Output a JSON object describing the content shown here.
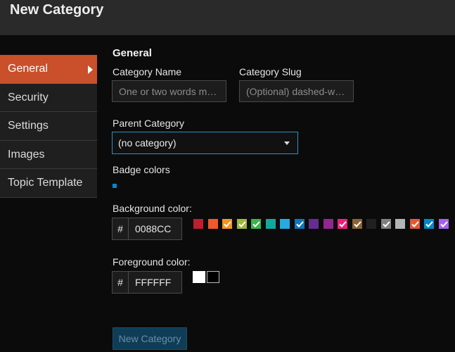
{
  "header": {
    "title": "New Category"
  },
  "nav": {
    "items": [
      {
        "label": "General",
        "active": true
      },
      {
        "label": "Security"
      },
      {
        "label": "Settings"
      },
      {
        "label": "Images"
      },
      {
        "label": "Topic Template"
      }
    ]
  },
  "general": {
    "title": "General",
    "category_name": {
      "label": "Category Name",
      "placeholder": "One or two words maximum"
    },
    "category_slug": {
      "label": "Category Slug",
      "placeholder": "(Optional) dashed-words for url"
    },
    "parent": {
      "label": "Parent Category",
      "value": "(no category)"
    },
    "badge_label": "Badge colors",
    "background": {
      "label": "Background color:",
      "hash": "#",
      "value": "0088CC",
      "swatches": [
        {
          "color": "#BF1E2E",
          "checked": false
        },
        {
          "color": "#F1592A",
          "checked": false
        },
        {
          "color": "#F7941D",
          "checked": true
        },
        {
          "color": "#9EB83B",
          "checked": true
        },
        {
          "color": "#3AB54A",
          "checked": true
        },
        {
          "color": "#12A89D",
          "checked": false
        },
        {
          "color": "#25AAE2",
          "checked": false
        },
        {
          "color": "#0E76BD",
          "checked": true
        },
        {
          "color": "#652D90",
          "checked": false
        },
        {
          "color": "#92278F",
          "checked": false
        },
        {
          "color": "#ED207B",
          "checked": true
        },
        {
          "color": "#8C6238",
          "checked": true
        },
        {
          "color": "#231F20",
          "checked": false
        },
        {
          "color": "#808281",
          "checked": true
        },
        {
          "color": "#B3B5B4",
          "checked": false
        },
        {
          "color": "#E45735",
          "checked": true
        },
        {
          "color": "#0088CC",
          "checked": true
        },
        {
          "color": "#A461EF",
          "checked": true
        }
      ]
    },
    "foreground": {
      "label": "Foreground color:",
      "hash": "#",
      "value": "FFFFFF",
      "swatches": [
        {
          "color": "#FFFFFF"
        },
        {
          "color": "#000000"
        }
      ]
    }
  },
  "actions": {
    "submit_label": "New Category"
  }
}
